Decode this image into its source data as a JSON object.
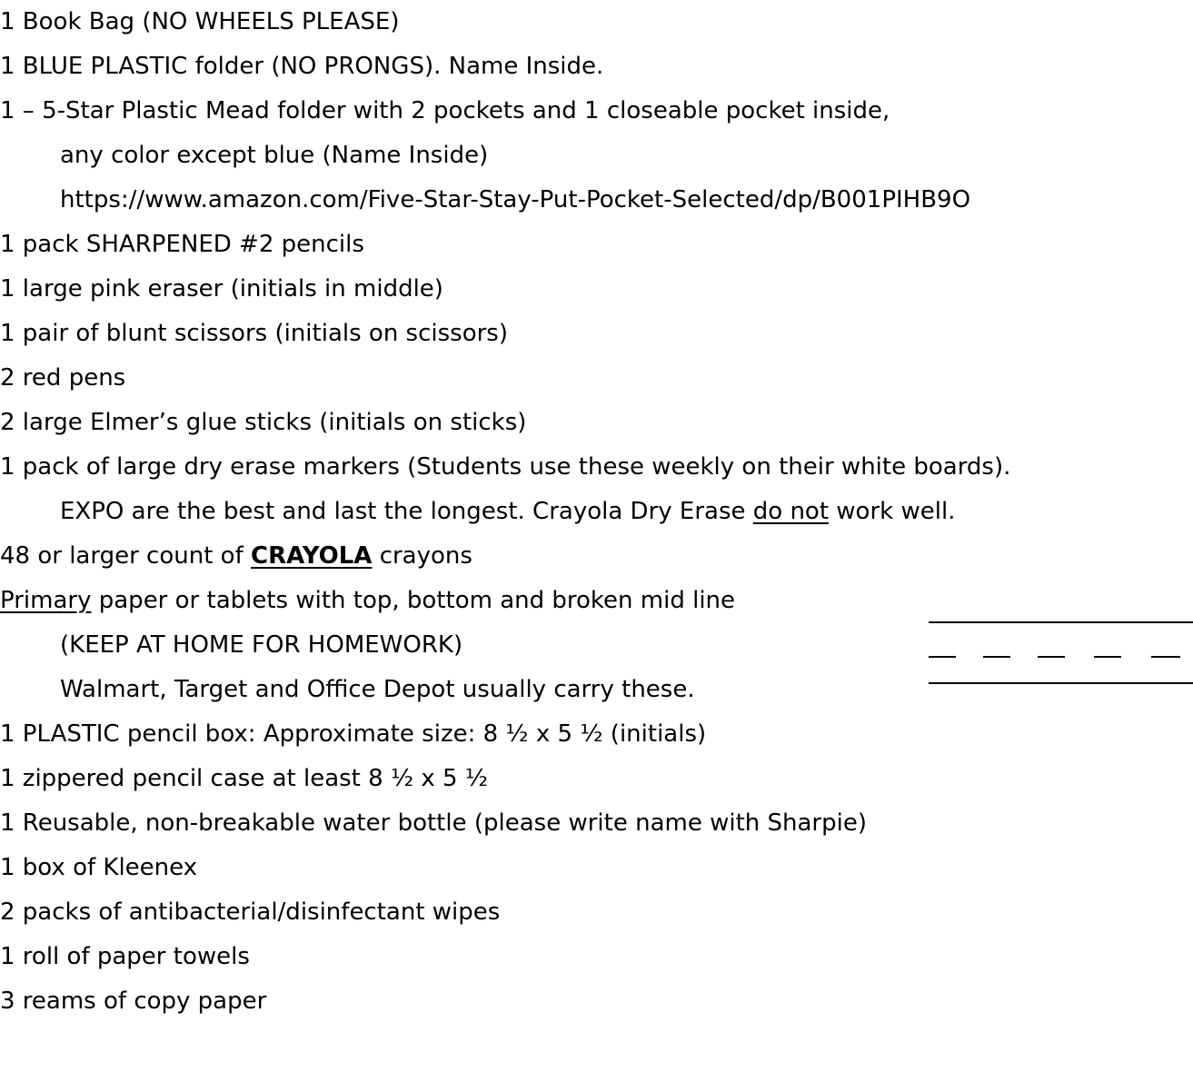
{
  "items": [
    "1 Book Bag (NO WHEELS PLEASE)",
    "1 BLUE PLASTIC folder (NO PRONGS).  Name Inside.",
    "1 – 5-Star Plastic Mead folder with 2 pockets and 1 closeable pocket inside,",
    "any color except blue (Name Inside)",
    "https://www.amazon.com/Five-Star-Stay-Put-Pocket-Selected/dp/B001PIHB9O",
    "1 pack SHARPENED #2 pencils",
    "1 large pink eraser (initials in middle)",
    "1 pair of blunt scissors (initials on scissors)",
    "2 red pens",
    "2 large Elmer’s glue sticks (initials on sticks)",
    "1 pack of large dry erase markers (Students use these weekly on their white boards).",
    "EXPO are the best and last the longest.  Crayola Dry Erase ",
    "do not",
    " work well.",
    "48 or larger count of ",
    "CRAYOLA",
    " crayons",
    "Primary",
    " paper or tablets with top, bottom and broken mid line",
    "(KEEP AT HOME FOR HOMEWORK)",
    "Walmart, Target and Office Depot usually carry these.",
    "1 PLASTIC pencil box: Approximate size:  8 ½ x 5 ½ (initials)",
    "1 zippered pencil case at least 8 ½ x 5 ½",
    "1 Reusable, non-breakable water bottle (please write name with Sharpie)",
    "1 box of Kleenex",
    "2 packs of antibacterial/disinfectant wipes",
    "1 roll of paper towels",
    "3 reams of copy paper"
  ]
}
